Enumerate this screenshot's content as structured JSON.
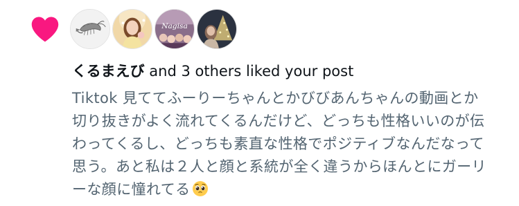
{
  "notification": {
    "icon": "heart-icon",
    "heart_color": "#f91880",
    "avatars": [
      {
        "icon": "shrimp-avatar"
      },
      {
        "icon": "person-photo-avatar"
      },
      {
        "icon": "nagisa-group-photo-avatar"
      },
      {
        "icon": "night-tree-photo-avatar"
      }
    ],
    "username": "くるまえび",
    "action_text": " and 3 others liked your post",
    "post_lines": [
      "Tiktok 見ててふーりーちゃんとかびびあんちゃんの動画とか",
      "切り抜きがよく流れてくるんだけど、どっちも性格いいのが伝",
      "わってくるし、どっちも素直な性格でポジティブなんだなって",
      "思う。あと私は２人と顔と系統が全く違うからほんとにガーリ",
      "ーな顔に憧れてる"
    ],
    "post_emoji": "pleading-face-emoji",
    "text_color": "#0f1419",
    "secondary_text_color": "#536471"
  }
}
